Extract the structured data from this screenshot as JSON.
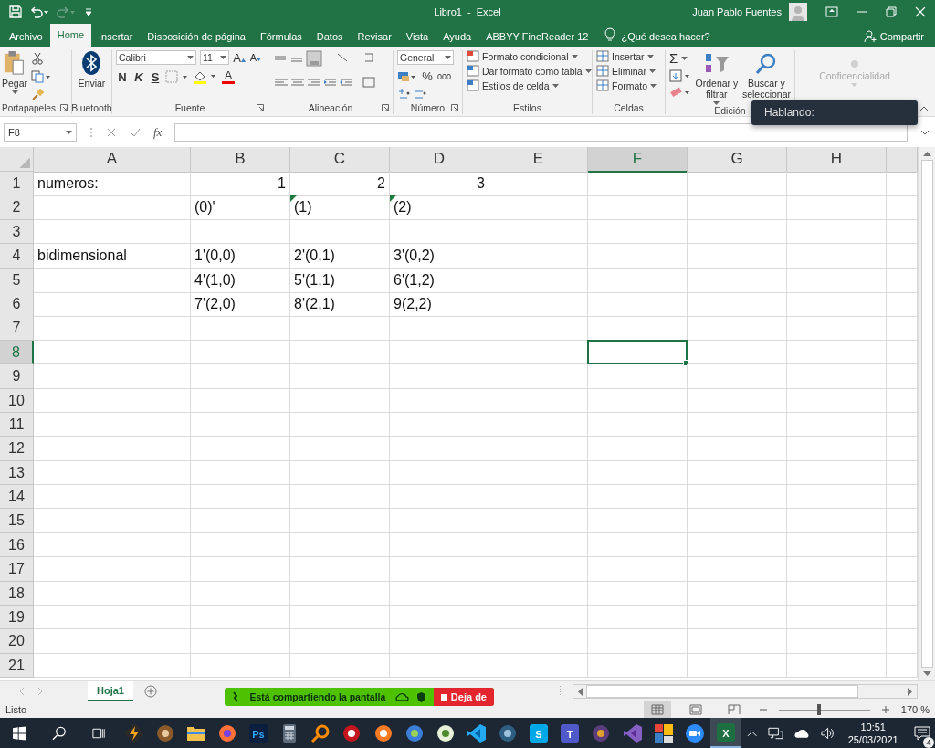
{
  "title_bar": {
    "document_title": "Libro1  -  Excel",
    "user": "Juan Pablo Fuentes"
  },
  "ribbon_tabs": [
    {
      "label": "Archivo",
      "selected": false
    },
    {
      "label": "Home",
      "selected": true
    },
    {
      "label": "Insertar",
      "selected": false
    },
    {
      "label": "Disposición de página",
      "selected": false
    },
    {
      "label": "Fórmulas",
      "selected": false
    },
    {
      "label": "Datos",
      "selected": false
    },
    {
      "label": "Revisar",
      "selected": false
    },
    {
      "label": "Vista",
      "selected": false
    },
    {
      "label": "Ayuda",
      "selected": false
    },
    {
      "label": "ABBYY FineReader 12",
      "selected": false
    }
  ],
  "tell_me": "¿Qué desea hacer?",
  "share": "Compartir",
  "clipboard": {
    "label": "Portapapeles",
    "paste": "Pegar"
  },
  "bluetooth": {
    "label": "Bluetooth",
    "send": "Enviar"
  },
  "font": {
    "label": "Fuente",
    "font_name": "Calibri",
    "font_size": "11",
    "grow": "A",
    "shrink": "A",
    "bold": "N",
    "italic": "K",
    "underline": "S",
    "font_color": "A"
  },
  "alignment": {
    "label": "Alineación"
  },
  "number": {
    "label": "Número",
    "format": "General",
    "percent": "%",
    "thousands": "000"
  },
  "styles": {
    "label": "Estilos",
    "items": [
      "Formato condicional",
      "Dar formato como tabla",
      "Estilos de celda"
    ]
  },
  "cells_group": {
    "label": "Celdas",
    "items": [
      "Insertar",
      "Eliminar",
      "Formato"
    ]
  },
  "editing": {
    "label": "Edición",
    "sum": "Σ",
    "sort": "Ordenar y filtrar",
    "find": "Buscar y seleccionar"
  },
  "sensitivity": {
    "label": "Confidencialidad",
    "disabled": true
  },
  "tooltip": "Hablando:",
  "formula_bar": {
    "name_box": "F8",
    "fx": "fx"
  },
  "columns": [
    {
      "label": "A",
      "selected": false
    },
    {
      "label": "B",
      "selected": false
    },
    {
      "label": "C",
      "selected": false
    },
    {
      "label": "D",
      "selected": false
    },
    {
      "label": "E",
      "selected": false
    },
    {
      "label": "F",
      "selected": true
    },
    {
      "label": "G",
      "selected": false
    },
    {
      "label": "H",
      "selected": false
    }
  ],
  "rows": [
    {
      "label": "1",
      "selected": false,
      "cells": [
        {
          "text": "numeros:",
          "kind": "text",
          "flagged": false
        },
        {
          "text": "1",
          "kind": "number",
          "flagged": false
        },
        {
          "text": "2",
          "kind": "number",
          "flagged": false
        },
        {
          "text": "3",
          "kind": "number",
          "flagged": false
        }
      ]
    },
    {
      "label": "2",
      "selected": false,
      "cells": [
        null,
        {
          "text": "(0)'",
          "kind": "text",
          "flagged": false
        },
        {
          "text": "(1)",
          "kind": "text",
          "flagged": true
        },
        {
          "text": "(2)",
          "kind": "text",
          "flagged": true
        }
      ]
    },
    {
      "label": "3",
      "selected": false
    },
    {
      "label": "4",
      "selected": false,
      "cells": [
        {
          "text": "bidimensional",
          "kind": "text",
          "flagged": false
        },
        {
          "text": "1'(0,0)",
          "kind": "text",
          "flagged": false
        },
        {
          "text": "2'(0,1)",
          "kind": "text",
          "flagged": false
        },
        {
          "text": "3'(0,2)",
          "kind": "text",
          "flagged": false
        }
      ]
    },
    {
      "label": "5",
      "selected": false,
      "cells": [
        null,
        {
          "text": "4'(1,0)",
          "kind": "text",
          "flagged": false
        },
        {
          "text": "5'(1,1)",
          "kind": "text",
          "flagged": false
        },
        {
          "text": "6'(1,2)",
          "kind": "text",
          "flagged": false
        }
      ]
    },
    {
      "label": "6",
      "selected": false,
      "cells": [
        null,
        {
          "text": "7'(2,0)",
          "kind": "text",
          "flagged": false
        },
        {
          "text": "8'(2,1)",
          "kind": "text",
          "flagged": false
        },
        {
          "text": "9(2,2)",
          "kind": "text",
          "flagged": false
        }
      ]
    },
    {
      "label": "7",
      "selected": false
    },
    {
      "label": "8",
      "selected": true,
      "cells": [
        null,
        null,
        null,
        null,
        null,
        {
          "selected": true
        }
      ]
    },
    {
      "label": "9",
      "selected": false
    },
    {
      "label": "10",
      "selected": false
    },
    {
      "label": "11",
      "selected": false
    },
    {
      "label": "12",
      "selected": false
    },
    {
      "label": "13",
      "selected": false
    },
    {
      "label": "14",
      "selected": false
    },
    {
      "label": "15",
      "selected": false
    },
    {
      "label": "16",
      "selected": false
    },
    {
      "label": "17",
      "selected": false
    },
    {
      "label": "18",
      "selected": false
    },
    {
      "label": "19",
      "selected": false
    },
    {
      "label": "20",
      "selected": false
    },
    {
      "label": "21",
      "selected": false
    }
  ],
  "sheet_tabs": [
    {
      "label": "Hoja1",
      "selected": true
    }
  ],
  "share_banner": {
    "text": "Está compartiendo la pantalla",
    "stop": "Deja de"
  },
  "status_bar": {
    "status": "Listo",
    "views": [
      {
        "kind": "normal",
        "selected": true
      },
      {
        "kind": "page_layout",
        "selected": false
      },
      {
        "kind": "page_break",
        "selected": false
      }
    ],
    "zoom": {
      "level": 0.44,
      "reading": "170 %"
    }
  },
  "taskbar": {
    "apps": [
      {
        "kind": "bolt",
        "active": false
      },
      {
        "kind": "mule",
        "active": false
      },
      {
        "kind": "folder",
        "active": false
      },
      {
        "kind": "firefox",
        "active": false
      },
      {
        "kind": "tile",
        "glyph": "Ps",
        "active": false
      },
      {
        "kind": "calculator",
        "active": false
      },
      {
        "kind": "magnifier",
        "active": false
      },
      {
        "kind": "reader",
        "active": false
      },
      {
        "kind": "xampp",
        "active": false
      },
      {
        "kind": "cube",
        "active": false
      },
      {
        "kind": "notepad",
        "active": false
      },
      {
        "kind": "vscode",
        "active": false
      },
      {
        "kind": "dolphin",
        "active": false
      },
      {
        "kind": "tile",
        "glyph": "S",
        "active": false
      },
      {
        "kind": "tile",
        "glyph": "T",
        "active": false
      },
      {
        "kind": "gear",
        "active": false
      },
      {
        "kind": "vstudio",
        "active": false
      },
      {
        "kind": "tiles",
        "active": false
      },
      {
        "kind": "camera",
        "active": false
      },
      {
        "kind": "tile",
        "glyph": "X",
        "active": true
      }
    ],
    "time": "10:51",
    "date": "25/03/2021",
    "notifications": "4"
  }
}
